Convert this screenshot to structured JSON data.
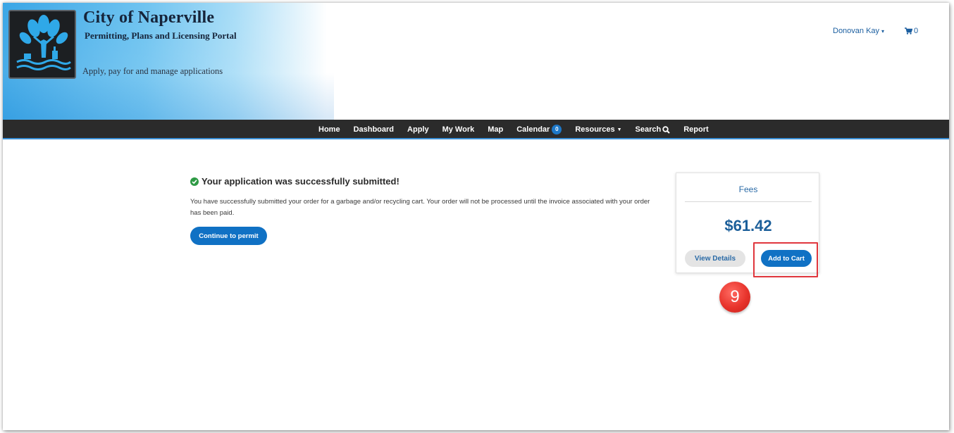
{
  "header": {
    "title": "City of Naperville",
    "subtitle": "Permitting, Plans and Licensing Portal",
    "tagline": "Apply, pay for and manage applications",
    "user_name": "Donovan Kay",
    "cart_count": "0"
  },
  "nav": {
    "items": [
      {
        "label": "Home"
      },
      {
        "label": "Dashboard"
      },
      {
        "label": "Apply"
      },
      {
        "label": "My Work"
      },
      {
        "label": "Map"
      },
      {
        "label": "Calendar",
        "badge": "0"
      },
      {
        "label": "Resources"
      },
      {
        "label": "Search"
      },
      {
        "label": "Report"
      }
    ]
  },
  "main": {
    "success_title": "Your application was successfully submitted!",
    "success_body": "You have successfully submitted your order for a garbage and/or recycling cart. Your order will not be processed until the invoice associated with your order has been paid.",
    "continue_label": "Continue to permit"
  },
  "fees": {
    "title": "Fees",
    "amount": "$61.42",
    "view_details_label": "View Details",
    "add_to_cart_label": "Add to Cart"
  },
  "annotation": {
    "step": "9"
  },
  "colors": {
    "nav_bg": "#2b2b2b",
    "primary_button": "#1071c4",
    "link_blue": "#1c5fa0",
    "success_green": "#2e9a45",
    "highlight_red": "#e0363d"
  }
}
